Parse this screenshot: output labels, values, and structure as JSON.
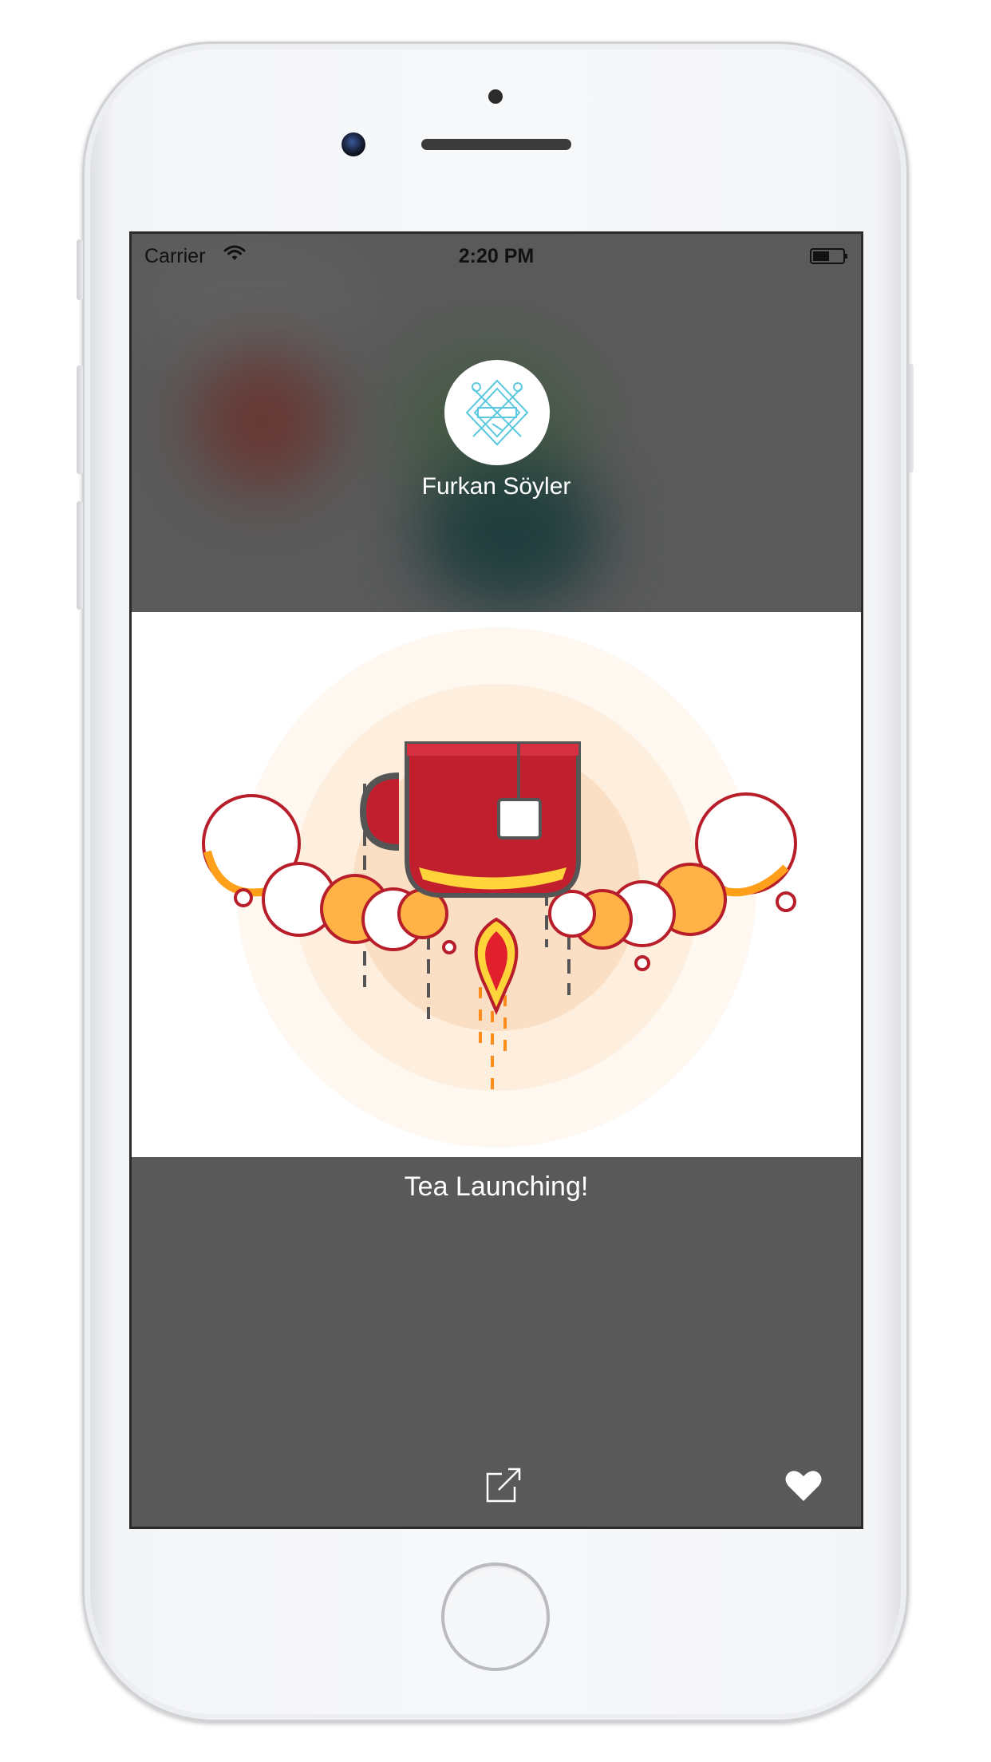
{
  "status_bar": {
    "carrier": "Carrier",
    "time": "2:20 PM"
  },
  "profile": {
    "name": "Furkan Söyler",
    "avatar_icon": "avatar-logo-icon"
  },
  "post": {
    "caption": "Tea Launching!",
    "image_icon": "tea-rocket-illustration"
  },
  "toolbar": {
    "share_icon": "share-icon",
    "like_icon": "heart-icon"
  },
  "colors": {
    "screen_background": "#595959",
    "avatar_line": "#5bc8e0",
    "mug_red": "#c21f2e",
    "flame_yellow": "#ffd43b",
    "glow_orange": "#f9c79a"
  }
}
